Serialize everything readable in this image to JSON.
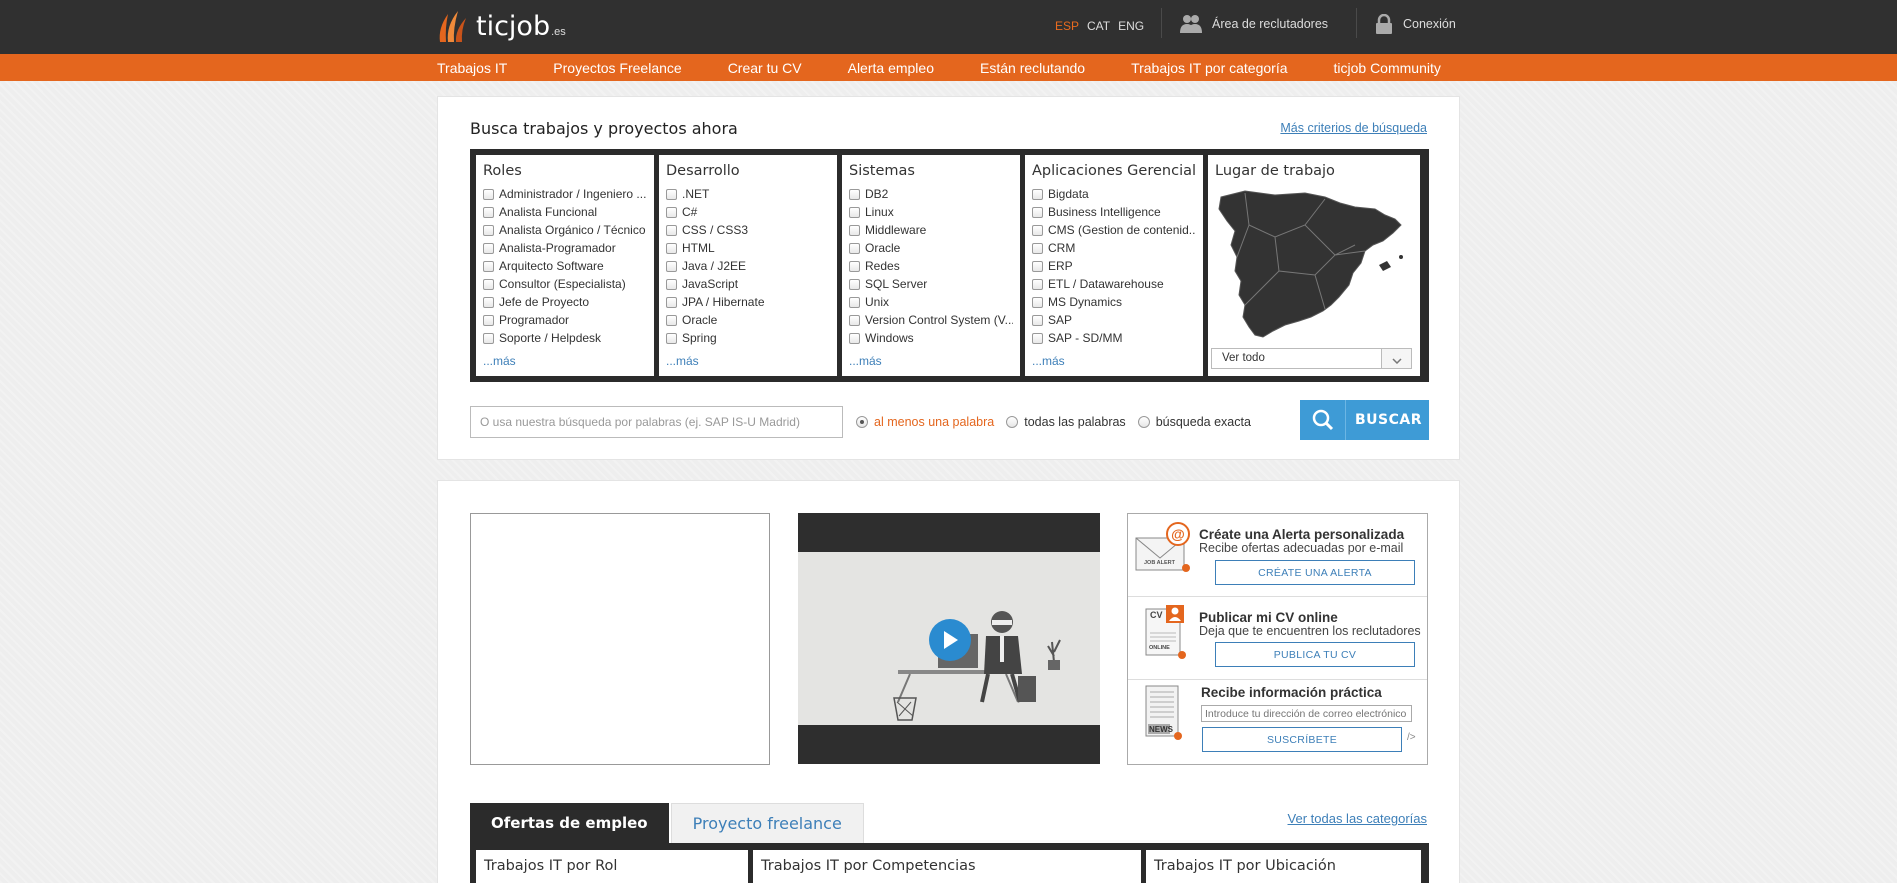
{
  "header": {
    "logo_text": "ticjob",
    "logo_tld": ".es",
    "languages": [
      {
        "label": "ESP",
        "active": true
      },
      {
        "label": "CAT",
        "active": false
      },
      {
        "label": "ENG",
        "active": false
      }
    ],
    "recruiters_label": "Área de reclutadores",
    "login_label": "Conexión"
  },
  "nav": {
    "items": [
      "Trabajos IT",
      "Proyectos Freelance",
      "Crear tu CV",
      "Alerta empleo",
      "Están reclutando",
      "Trabajos IT por categoría",
      "ticjob Community"
    ]
  },
  "search": {
    "title": "Busca trabajos y proyectos ahora",
    "more_criteria": "Más criterios de búsqueda",
    "columns": [
      {
        "title": "Roles",
        "items": [
          "Administrador / Ingeniero ...",
          "Analista Funcional",
          "Analista Orgánico / Técnico",
          "Analista-Programador",
          "Arquitecto Software",
          "Consultor (Especialista)",
          "Jefe de Proyecto",
          "Programador",
          "Soporte / Helpdesk"
        ],
        "more": "...más"
      },
      {
        "title": "Desarrollo",
        "items": [
          ".NET",
          "C#",
          "CSS / CSS3",
          "HTML",
          "Java / J2EE",
          "JavaScript",
          "JPA / Hibernate",
          "Oracle",
          "Spring"
        ],
        "more": "...más"
      },
      {
        "title": "Sistemas",
        "items": [
          "DB2",
          "Linux",
          "Middleware",
          "Oracle",
          "Redes",
          "SQL Server",
          "Unix",
          "Version Control System (V...",
          "Windows"
        ],
        "more": "...más"
      },
      {
        "title": "Aplicaciones Gerenciales",
        "items": [
          "Bigdata",
          "Business Intelligence",
          "CMS (Gestion de contenid...",
          "CRM",
          "ERP",
          "ETL / Datawarehouse",
          "MS Dynamics",
          "SAP",
          "SAP - SD/MM"
        ],
        "more": "...más"
      }
    ],
    "location": {
      "title": "Lugar de trabajo",
      "select_value": "Ver todo"
    },
    "keyword_placeholder": "O usa nuestra búsqueda por palabras (ej. SAP IS-U Madrid)",
    "radios": [
      {
        "label": "al menos una palabra",
        "selected": true
      },
      {
        "label": "todas las palabras",
        "selected": false
      },
      {
        "label": "búsqueda exacta",
        "selected": false
      }
    ],
    "button_label": "BUSCAR"
  },
  "sidebox": {
    "alert": {
      "title": "Créate una Alerta personalizada",
      "subtitle": "Recibe ofertas adecuadas por e-mail",
      "button": "CRÉATE UNA ALERTA",
      "icon_caption": "JOB ALERT"
    },
    "cv": {
      "title": "Publicar mi CV online",
      "subtitle": "Deja que te encuentren los reclutadores",
      "button": "PUBLICA TU CV",
      "icon_caption_top": "CV",
      "icon_caption_bottom": "ONLINE"
    },
    "news": {
      "title": "Recibe información práctica",
      "input_placeholder": "Introduce tu dirección de correo electrónico",
      "button": "SUSCRÍBETE",
      "trailing": "/>",
      "icon_caption": "NEWS"
    }
  },
  "tabs": {
    "items": [
      {
        "label": "Ofertas de empleo",
        "active": true
      },
      {
        "label": "Proyecto freelance",
        "active": false
      }
    ],
    "see_all": "Ver todas las categorías",
    "columns": [
      "Trabajos IT por Rol",
      "Trabajos IT por Competencias",
      "Trabajos IT por Ubicación"
    ]
  },
  "colors": {
    "accent": "#e4661e",
    "link": "#3d7fb8",
    "button": "#3e9bd6",
    "dark": "#2b2b2b"
  }
}
